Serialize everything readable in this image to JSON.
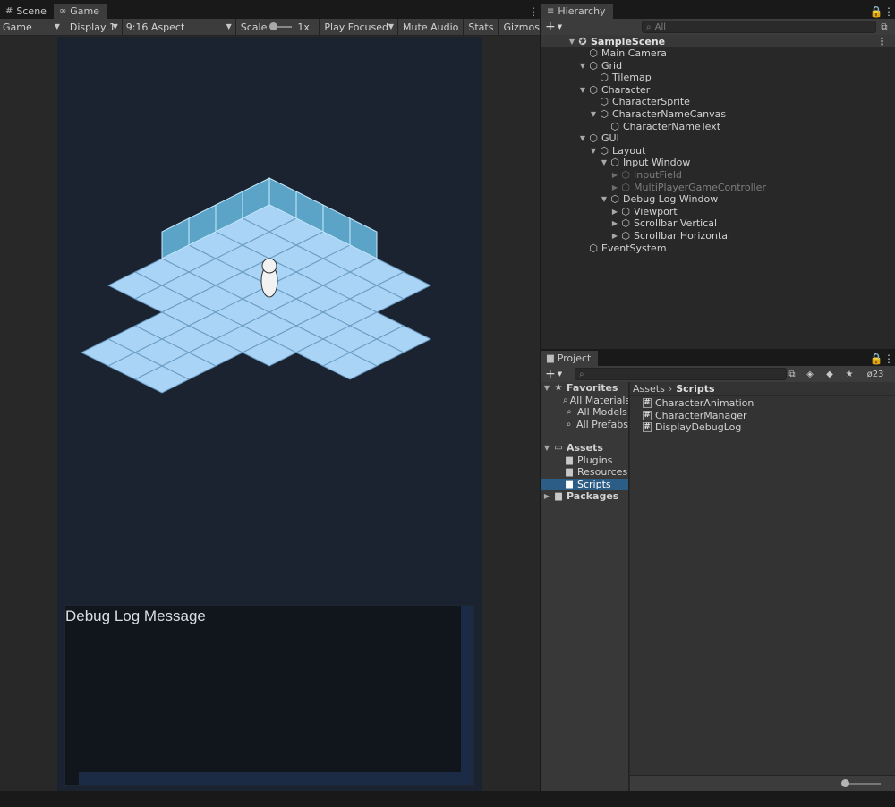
{
  "game_panel": {
    "tabs": [
      {
        "label": "Scene",
        "icon": "grid-icon",
        "active": false
      },
      {
        "label": "Game",
        "icon": "gamepad-icon",
        "active": true
      }
    ],
    "toolbar": {
      "view_mode": "Game",
      "display": "Display 1",
      "aspect": "9:16 Aspect",
      "scale_label": "Scale",
      "scale_value": "1x",
      "play_mode": "Play Focused",
      "mute": "Mute Audio",
      "stats": "Stats",
      "gizmos": "Gizmos"
    },
    "debug_window": {
      "title": "Debug Log Message"
    }
  },
  "hierarchy": {
    "tab_label": "Hierarchy",
    "search_placeholder": "All",
    "scene_name": "SampleScene",
    "items": [
      {
        "label": "Main Camera",
        "depth": 1,
        "fold": "",
        "dim": false
      },
      {
        "label": "Grid",
        "depth": 1,
        "fold": "open",
        "dim": false
      },
      {
        "label": "Tilemap",
        "depth": 2,
        "fold": "",
        "dim": false
      },
      {
        "label": "Character",
        "depth": 1,
        "fold": "open",
        "dim": false
      },
      {
        "label": "CharacterSprite",
        "depth": 2,
        "fold": "",
        "dim": false
      },
      {
        "label": "CharacterNameCanvas",
        "depth": 2,
        "fold": "open",
        "dim": false
      },
      {
        "label": "CharacterNameText",
        "depth": 3,
        "fold": "",
        "dim": false
      },
      {
        "label": "GUI",
        "depth": 1,
        "fold": "open",
        "dim": false
      },
      {
        "label": "Layout",
        "depth": 2,
        "fold": "open",
        "dim": false
      },
      {
        "label": "Input Window",
        "depth": 3,
        "fold": "open",
        "dim": false
      },
      {
        "label": "InputField",
        "depth": 4,
        "fold": "closed",
        "dim": true
      },
      {
        "label": "MultiPlayerGameController",
        "depth": 4,
        "fold": "closed",
        "dim": true
      },
      {
        "label": "Debug Log Window",
        "depth": 3,
        "fold": "open",
        "dim": false
      },
      {
        "label": "Viewport",
        "depth": 4,
        "fold": "closed",
        "dim": false
      },
      {
        "label": "Scrollbar Vertical",
        "depth": 4,
        "fold": "closed",
        "dim": false
      },
      {
        "label": "Scrollbar Horizontal",
        "depth": 4,
        "fold": "closed",
        "dim": false
      },
      {
        "label": "EventSystem",
        "depth": 1,
        "fold": "",
        "dim": false
      }
    ]
  },
  "project": {
    "tab_label": "Project",
    "hidden_count": "23",
    "favorites": {
      "label": "Favorites",
      "items": [
        "All Materials",
        "All Models",
        "All Prefabs"
      ]
    },
    "assets": {
      "label": "Assets",
      "items": [
        "Plugins",
        "Resources",
        "Scripts"
      ],
      "selected": "Scripts"
    },
    "packages_label": "Packages",
    "breadcrumb": [
      "Assets",
      "Scripts"
    ],
    "files": [
      "CharacterAnimation",
      "CharacterManager",
      "DisplayDebugLog"
    ]
  },
  "colors": {
    "editor_bg": "#282828",
    "panel_header": "#3c3c3c",
    "selection": "#2c5d87",
    "game_bg": "#1b2230",
    "tile": "#a9d4f5",
    "wall": "#5ba3c7"
  }
}
